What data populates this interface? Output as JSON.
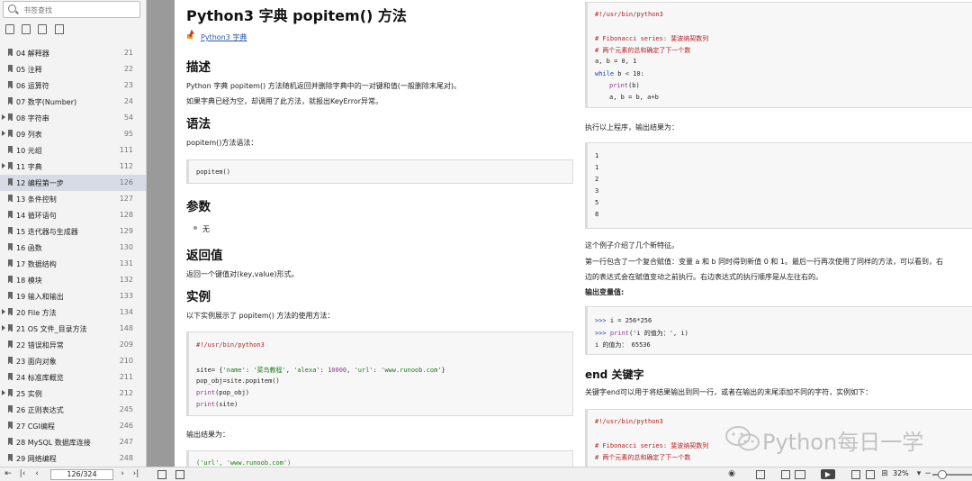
{
  "sidebar": {
    "search_placeholder": "书签查找",
    "bookmarks": [
      {
        "label": "04 解释器",
        "page": "21",
        "expandable": false
      },
      {
        "label": "05 注释",
        "page": "22",
        "expandable": false
      },
      {
        "label": "06 运算符",
        "page": "23",
        "expandable": false
      },
      {
        "label": "07 数字(Number)",
        "page": "24",
        "expandable": false
      },
      {
        "label": "08 字符串",
        "page": "54",
        "expandable": true
      },
      {
        "label": "09 列表",
        "page": "95",
        "expandable": true
      },
      {
        "label": "10 元组",
        "page": "111",
        "expandable": false
      },
      {
        "label": "11 字典",
        "page": "112",
        "expandable": true
      },
      {
        "label": "12 编程第一步",
        "page": "126",
        "expandable": false,
        "selected": true
      },
      {
        "label": "13 条件控制",
        "page": "127",
        "expandable": false
      },
      {
        "label": "14 循环语句",
        "page": "128",
        "expandable": false
      },
      {
        "label": "15 迭代器与生成器",
        "page": "129",
        "expandable": false
      },
      {
        "label": "16 函数",
        "page": "130",
        "expandable": false
      },
      {
        "label": "17 数据结构",
        "page": "131",
        "expandable": false
      },
      {
        "label": "18 模块",
        "page": "132",
        "expandable": false
      },
      {
        "label": "19 输入和输出",
        "page": "133",
        "expandable": false
      },
      {
        "label": "20 File 方法",
        "page": "134",
        "expandable": true
      },
      {
        "label": "21 OS 文件_目录方法",
        "page": "148",
        "expandable": true
      },
      {
        "label": "22 错误和异常",
        "page": "209",
        "expandable": false
      },
      {
        "label": "23 面向对象",
        "page": "210",
        "expandable": false
      },
      {
        "label": "24 标准库概览",
        "page": "211",
        "expandable": false
      },
      {
        "label": "25 实例",
        "page": "212",
        "expandable": true
      },
      {
        "label": "26 正则表达式",
        "page": "245",
        "expandable": false
      },
      {
        "label": "27 CGI编程",
        "page": "246",
        "expandable": false
      },
      {
        "label": "28 MySQL 数据库连接",
        "page": "247",
        "expandable": false
      },
      {
        "label": "29 网络编程",
        "page": "248",
        "expandable": false
      }
    ]
  },
  "left_page": {
    "title": "Python3 字典 popitem() 方法",
    "breadcrumb": "Python3 字典",
    "h_desc": "描述",
    "desc1": "Python 字典 popitem() 方法随机返回并删除字典中的一对键和值(一般删除末尾对)。",
    "desc2": "如果字典已经为空，却调用了此方法，就报出KeyError异常。",
    "h_syntax": "语法",
    "syntax_intro": "popitem()方法语法：",
    "syntax_code": "popitem()",
    "h_params": "参数",
    "params_item": "无",
    "h_return": "返回值",
    "return_text": "返回一个键值对(key,value)形式。",
    "h_example": "实例",
    "example_intro": "以下实例展示了 popitem() 方法的使用方法：",
    "example_code": {
      "shebang": "#!/usr/bin/python3",
      "l1a": "site= {",
      "l1b": "'name'",
      "l1c": ": ",
      "l1d": "'菜鸟教程'",
      "l1e": ", ",
      "l1f": "'alexa'",
      "l1g": ": ",
      "l1h": "10000",
      "l1i": ", ",
      "l1j": "'url'",
      "l1k": ": ",
      "l1l": "'www.runoob.com'",
      "l1m": "}",
      "l2": "pop_obj=site.popitem()",
      "l3a": "print",
      "l3b": "(pop_obj)",
      "l4a": "print",
      "l4b": "(site)"
    },
    "output_label": "输出结果为：",
    "output_code": "('url', 'www.runoob.com')"
  },
  "right_page": {
    "code1": {
      "shebang": "#!/usr/bin/python3",
      "c1": "# Fibonacci series: 斐波纳契数列",
      "c2": "# 两个元素的总和确定了下一个数",
      "l1": "a, b = 0, 1",
      "l2a": "while",
      "l2b": " b < 10:",
      "l3a": "print",
      "l3b": "(b)",
      "l4": "a, b = b, a+b"
    },
    "run_label": "执行以上程序，输出结果为：",
    "output_lines": [
      "1",
      "1",
      "2",
      "3",
      "5",
      "8"
    ],
    "para1": "这个例子介绍了几个新特征。",
    "para2": "第一行包含了一个复合赋值：变量 a 和 b 同时得到新值 0 和 1。最后一行再次使用了同样的方法，可以看到，右",
    "para3": "边的表达式会在赋值变动之前执行。右边表达式的执行顺序是从左往右的。",
    "h_outvar": "输出变量值:",
    "code2": {
      "l1a": ">>> ",
      "l1b": "i = 256*256",
      "l2a": ">>> ",
      "l2b": "print",
      "l2c": "('i 的值为：', i)",
      "l3": "i 的值为： 65536"
    },
    "h_end": "end 关键字",
    "end_text": "关键字end可以用于将结果输出到同一行，或者在输出的末尾添加不同的字符，实例如下：",
    "code3": {
      "shebang": "#!/usr/bin/python3",
      "c1": "# Fibonacci series: 斐波纳契数列",
      "c2": "# 两个元素的总和确定了下一个数"
    }
  },
  "watermark": "Python每日一学",
  "statusbar": {
    "page_indicator": "126/324",
    "zoom": "32%"
  }
}
